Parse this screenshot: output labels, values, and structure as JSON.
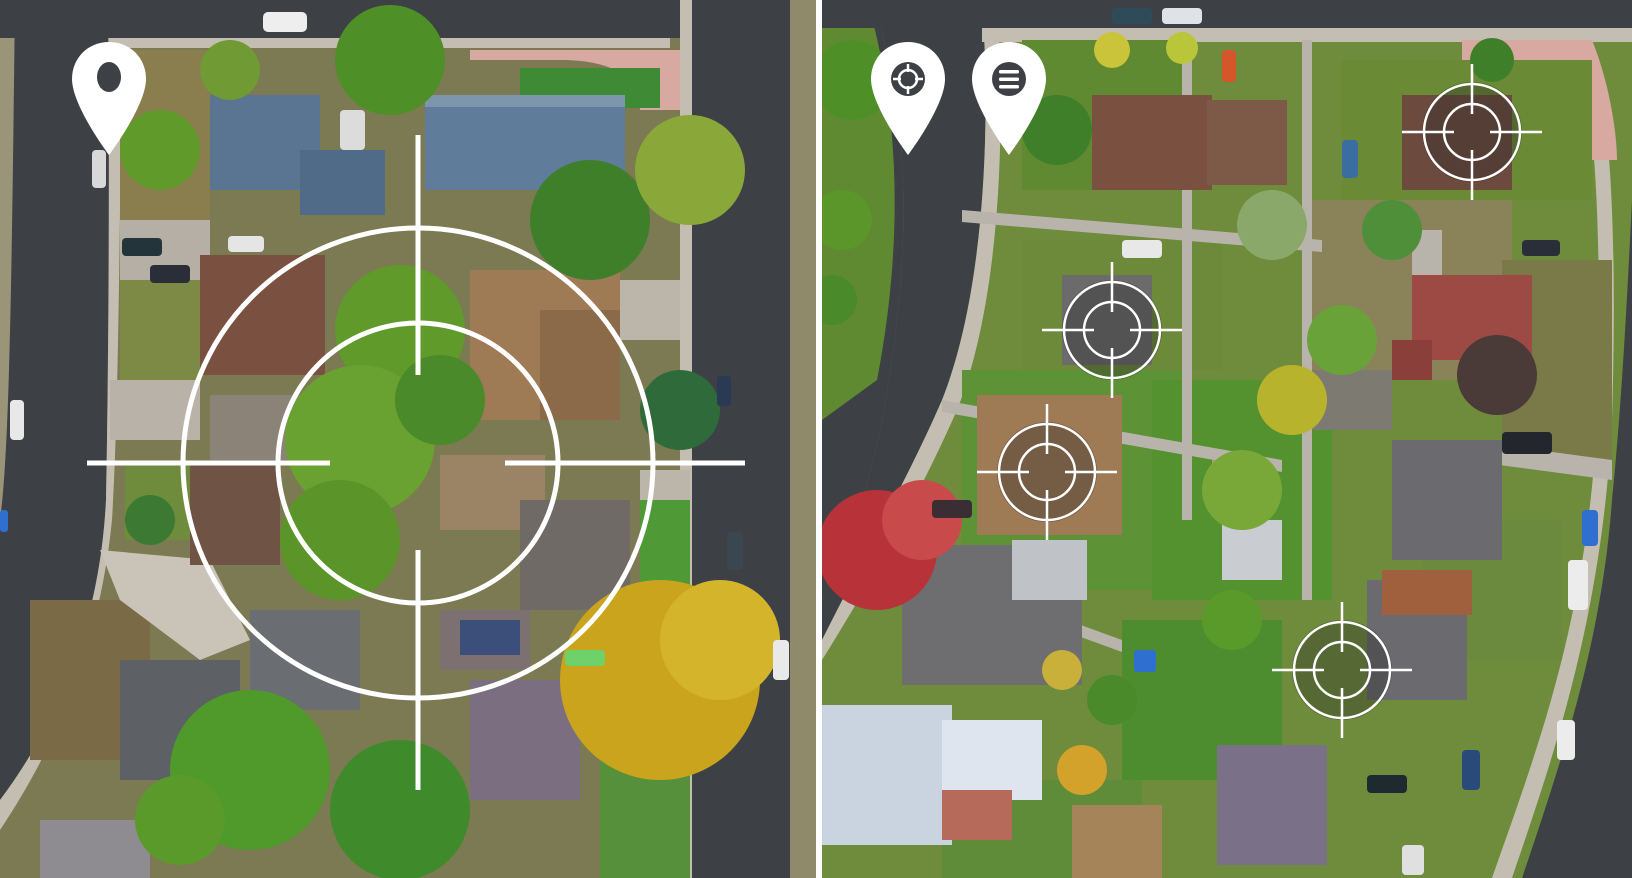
{
  "scene": {
    "description_icons": [
      "location-pin-icon",
      "target-pin-icon",
      "menu-pin-icon",
      "crosshair-icon"
    ]
  },
  "colors": {
    "road": "#3d4146",
    "grass": "#6f8c3c",
    "dry_grass": "#8c8258",
    "sidewalk": "#b9b4ab",
    "tree": "#5f9a2a",
    "tree_yellow": "#c9a41c",
    "tree_red": "#b8323a",
    "roof_blue": "#5a7592",
    "roof_brown": "#7a5140",
    "roof_tan": "#9e7a55",
    "roof_gray": "#6f6a66",
    "overlay_white": "#ffffff"
  }
}
